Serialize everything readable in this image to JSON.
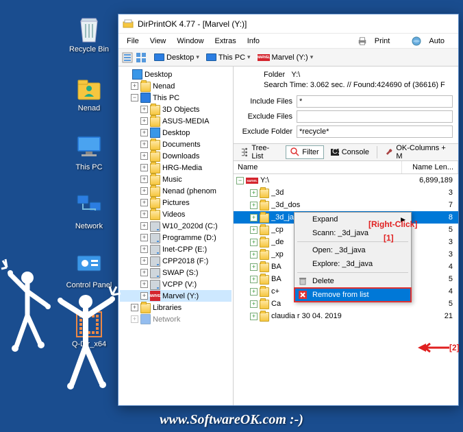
{
  "desktop": {
    "icons": [
      {
        "label": "Recycle Bin"
      },
      {
        "label": "Nenad"
      },
      {
        "label": "This PC"
      },
      {
        "label": "Network"
      },
      {
        "label": "Control Panel"
      },
      {
        "label": "Q-Dir_x64"
      }
    ]
  },
  "window": {
    "title": "DirPrintOK 4.77 - [Marvel (Y:)]",
    "menu": {
      "file": "File",
      "view": "View",
      "window": "Window",
      "extras": "Extras",
      "info": "Info",
      "print": "Print",
      "auto": "Auto"
    },
    "breadcrumb": {
      "b1": "Desktop",
      "b2": "This PC",
      "b3": "Marvel (Y:)"
    },
    "tree": {
      "desktop": "Desktop",
      "nenad": "Nenad",
      "thispc": "This PC",
      "items": [
        "3D Objects",
        "ASUS-MEDIA",
        "Desktop",
        "Documents",
        "Downloads",
        "HRG-Media",
        "Music",
        "Nenad (phenom",
        "Pictures",
        "Videos",
        "W10_2020d (C:)",
        "Programme (D:)",
        "Inet-CPP (E:)",
        "CPP2018 (F:)",
        "SWAP (S:)",
        "VCPP (V:)",
        "Marvel (Y:)"
      ],
      "libraries": "Libraries",
      "network": "Network"
    },
    "info": {
      "folder_lab": "Folder",
      "folder_val": "Y:\\",
      "search_line": "Search Time: 3.062 sec. //  Found:424690 of (36616) F",
      "include_lab": "Include Files",
      "include_val": "*",
      "exclude_lab": "Exclude Files",
      "exclude_val": "",
      "exfold_lab": "Exclude Folder",
      "exfold_val": "*recycle*"
    },
    "tabs": {
      "tree": "Tree-List",
      "filter": "Filter",
      "console": "Console",
      "okcol": "OK-Columns + M"
    },
    "list": {
      "col_name": "Name",
      "col_len": "Name Len...",
      "root": {
        "name": "Y:\\",
        "len": "6,899,189"
      },
      "rows": [
        {
          "name": "_3d",
          "len": "3"
        },
        {
          "name": "_3d_dos",
          "len": "7"
        },
        {
          "name": "_3d_ja",
          "len": "8"
        },
        {
          "name": "_cp",
          "len": "5"
        },
        {
          "name": "_de",
          "len": "3"
        },
        {
          "name": "_xp",
          "len": "3"
        },
        {
          "name": "BA",
          "len": "4"
        },
        {
          "name": "BA",
          "len": "5"
        },
        {
          "name": "c+",
          "len": "4"
        },
        {
          "name": "Ca",
          "len": "5"
        },
        {
          "name": "claudia r 30 04. 2019",
          "len": "21"
        }
      ]
    },
    "ctx": {
      "expand": "Expand",
      "scan": "Scann: _3d_java",
      "open": "Open: _3d_java",
      "explore": "Explore: _3d_java",
      "delete": "Delete",
      "remove": "Remove from list"
    }
  },
  "annot": {
    "rc": "[Right-Click]",
    "n1": "[1]",
    "n2": "[2]"
  },
  "footer": "www.SoftwareOK.com :-)"
}
